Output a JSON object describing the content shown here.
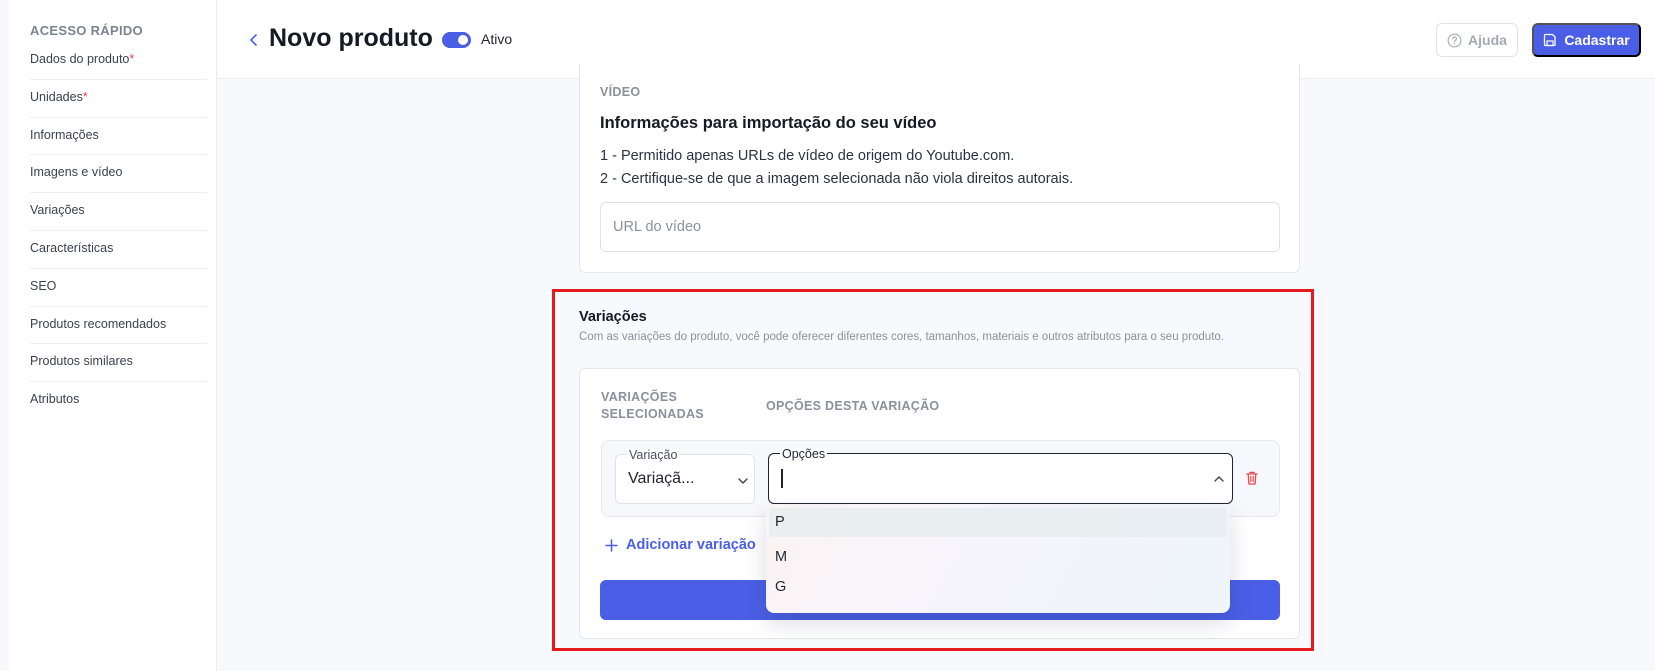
{
  "sidebar": {
    "title": "ACESSO RÁPIDO",
    "items": [
      {
        "label": "Dados do produto",
        "required": "*"
      },
      {
        "label": "Unidades",
        "required": "*"
      },
      {
        "label": "Informações"
      },
      {
        "label": "Imagens e vídeo"
      },
      {
        "label": "Variações"
      },
      {
        "label": "Características"
      },
      {
        "label": "SEO"
      },
      {
        "label": "Produtos recomendados"
      },
      {
        "label": "Produtos similares"
      },
      {
        "label": "Atributos"
      }
    ]
  },
  "header": {
    "title": "Novo produto",
    "active_label": "Ativo",
    "active": true,
    "help_label": "Ajuda",
    "submit_label": "Cadastrar"
  },
  "video": {
    "label": "VÍDEO",
    "heading": "Informações para importação do seu vídeo",
    "rules": [
      "1 - Permitido apenas URLs de vídeo de origem do Youtube.com.",
      "2 - Certifique-se de que a imagem selecionada não viola direitos autorais."
    ],
    "input_placeholder": "URL do vídeo"
  },
  "variations": {
    "title": "Variações",
    "description": "Com as variações do produto, você pode oferecer diferentes cores, tamanhos, materiais e outros atributos para o seu produto.",
    "col_selected_line1": "VARIAÇÕES",
    "col_selected_line2": "SELECIONADAS",
    "col_options": "OPÇÕES DESTA VARIAÇÃO",
    "row": {
      "variation_legend": "Variação",
      "variation_value": "Variaçã...",
      "options_legend": "Opções",
      "options_value": ""
    },
    "add_label": "Adicionar variação",
    "dropdown_options": [
      "P",
      "M",
      "G"
    ]
  },
  "colors": {
    "accent": "#4a5ee6",
    "highlight_border": "#e31b1b",
    "required": "#e5484d",
    "danger_icon": "#e5484d"
  }
}
